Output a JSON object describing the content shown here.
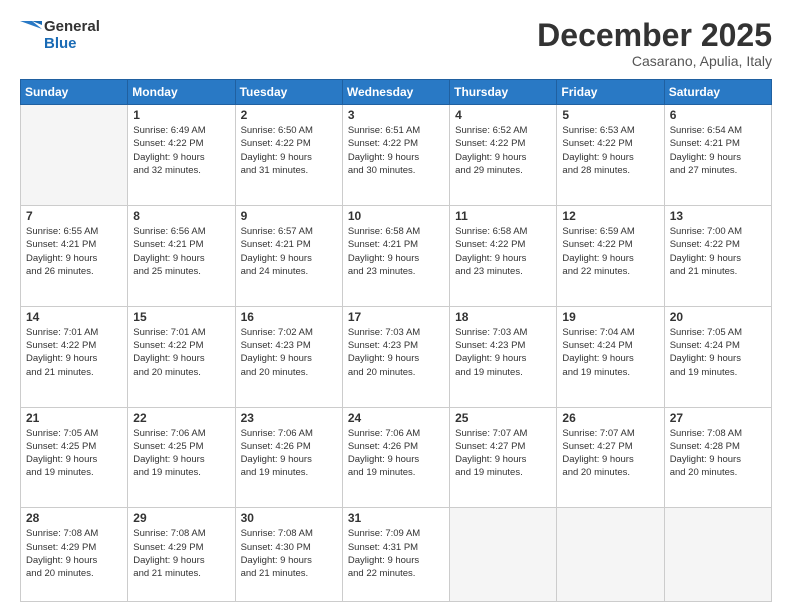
{
  "header": {
    "logo_line1": "General",
    "logo_line2": "Blue",
    "month_title": "December 2025",
    "subtitle": "Casarano, Apulia, Italy"
  },
  "weekdays": [
    "Sunday",
    "Monday",
    "Tuesday",
    "Wednesday",
    "Thursday",
    "Friday",
    "Saturday"
  ],
  "weeks": [
    [
      {
        "day": "",
        "info": ""
      },
      {
        "day": "1",
        "info": "Sunrise: 6:49 AM\nSunset: 4:22 PM\nDaylight: 9 hours\nand 32 minutes."
      },
      {
        "day": "2",
        "info": "Sunrise: 6:50 AM\nSunset: 4:22 PM\nDaylight: 9 hours\nand 31 minutes."
      },
      {
        "day": "3",
        "info": "Sunrise: 6:51 AM\nSunset: 4:22 PM\nDaylight: 9 hours\nand 30 minutes."
      },
      {
        "day": "4",
        "info": "Sunrise: 6:52 AM\nSunset: 4:22 PM\nDaylight: 9 hours\nand 29 minutes."
      },
      {
        "day": "5",
        "info": "Sunrise: 6:53 AM\nSunset: 4:22 PM\nDaylight: 9 hours\nand 28 minutes."
      },
      {
        "day": "6",
        "info": "Sunrise: 6:54 AM\nSunset: 4:21 PM\nDaylight: 9 hours\nand 27 minutes."
      }
    ],
    [
      {
        "day": "7",
        "info": "Sunrise: 6:55 AM\nSunset: 4:21 PM\nDaylight: 9 hours\nand 26 minutes."
      },
      {
        "day": "8",
        "info": "Sunrise: 6:56 AM\nSunset: 4:21 PM\nDaylight: 9 hours\nand 25 minutes."
      },
      {
        "day": "9",
        "info": "Sunrise: 6:57 AM\nSunset: 4:21 PM\nDaylight: 9 hours\nand 24 minutes."
      },
      {
        "day": "10",
        "info": "Sunrise: 6:58 AM\nSunset: 4:21 PM\nDaylight: 9 hours\nand 23 minutes."
      },
      {
        "day": "11",
        "info": "Sunrise: 6:58 AM\nSunset: 4:22 PM\nDaylight: 9 hours\nand 23 minutes."
      },
      {
        "day": "12",
        "info": "Sunrise: 6:59 AM\nSunset: 4:22 PM\nDaylight: 9 hours\nand 22 minutes."
      },
      {
        "day": "13",
        "info": "Sunrise: 7:00 AM\nSunset: 4:22 PM\nDaylight: 9 hours\nand 21 minutes."
      }
    ],
    [
      {
        "day": "14",
        "info": "Sunrise: 7:01 AM\nSunset: 4:22 PM\nDaylight: 9 hours\nand 21 minutes."
      },
      {
        "day": "15",
        "info": "Sunrise: 7:01 AM\nSunset: 4:22 PM\nDaylight: 9 hours\nand 20 minutes."
      },
      {
        "day": "16",
        "info": "Sunrise: 7:02 AM\nSunset: 4:23 PM\nDaylight: 9 hours\nand 20 minutes."
      },
      {
        "day": "17",
        "info": "Sunrise: 7:03 AM\nSunset: 4:23 PM\nDaylight: 9 hours\nand 20 minutes."
      },
      {
        "day": "18",
        "info": "Sunrise: 7:03 AM\nSunset: 4:23 PM\nDaylight: 9 hours\nand 19 minutes."
      },
      {
        "day": "19",
        "info": "Sunrise: 7:04 AM\nSunset: 4:24 PM\nDaylight: 9 hours\nand 19 minutes."
      },
      {
        "day": "20",
        "info": "Sunrise: 7:05 AM\nSunset: 4:24 PM\nDaylight: 9 hours\nand 19 minutes."
      }
    ],
    [
      {
        "day": "21",
        "info": "Sunrise: 7:05 AM\nSunset: 4:25 PM\nDaylight: 9 hours\nand 19 minutes."
      },
      {
        "day": "22",
        "info": "Sunrise: 7:06 AM\nSunset: 4:25 PM\nDaylight: 9 hours\nand 19 minutes."
      },
      {
        "day": "23",
        "info": "Sunrise: 7:06 AM\nSunset: 4:26 PM\nDaylight: 9 hours\nand 19 minutes."
      },
      {
        "day": "24",
        "info": "Sunrise: 7:06 AM\nSunset: 4:26 PM\nDaylight: 9 hours\nand 19 minutes."
      },
      {
        "day": "25",
        "info": "Sunrise: 7:07 AM\nSunset: 4:27 PM\nDaylight: 9 hours\nand 19 minutes."
      },
      {
        "day": "26",
        "info": "Sunrise: 7:07 AM\nSunset: 4:27 PM\nDaylight: 9 hours\nand 20 minutes."
      },
      {
        "day": "27",
        "info": "Sunrise: 7:08 AM\nSunset: 4:28 PM\nDaylight: 9 hours\nand 20 minutes."
      }
    ],
    [
      {
        "day": "28",
        "info": "Sunrise: 7:08 AM\nSunset: 4:29 PM\nDaylight: 9 hours\nand 20 minutes."
      },
      {
        "day": "29",
        "info": "Sunrise: 7:08 AM\nSunset: 4:29 PM\nDaylight: 9 hours\nand 21 minutes."
      },
      {
        "day": "30",
        "info": "Sunrise: 7:08 AM\nSunset: 4:30 PM\nDaylight: 9 hours\nand 21 minutes."
      },
      {
        "day": "31",
        "info": "Sunrise: 7:09 AM\nSunset: 4:31 PM\nDaylight: 9 hours\nand 22 minutes."
      },
      {
        "day": "",
        "info": ""
      },
      {
        "day": "",
        "info": ""
      },
      {
        "day": "",
        "info": ""
      }
    ]
  ]
}
